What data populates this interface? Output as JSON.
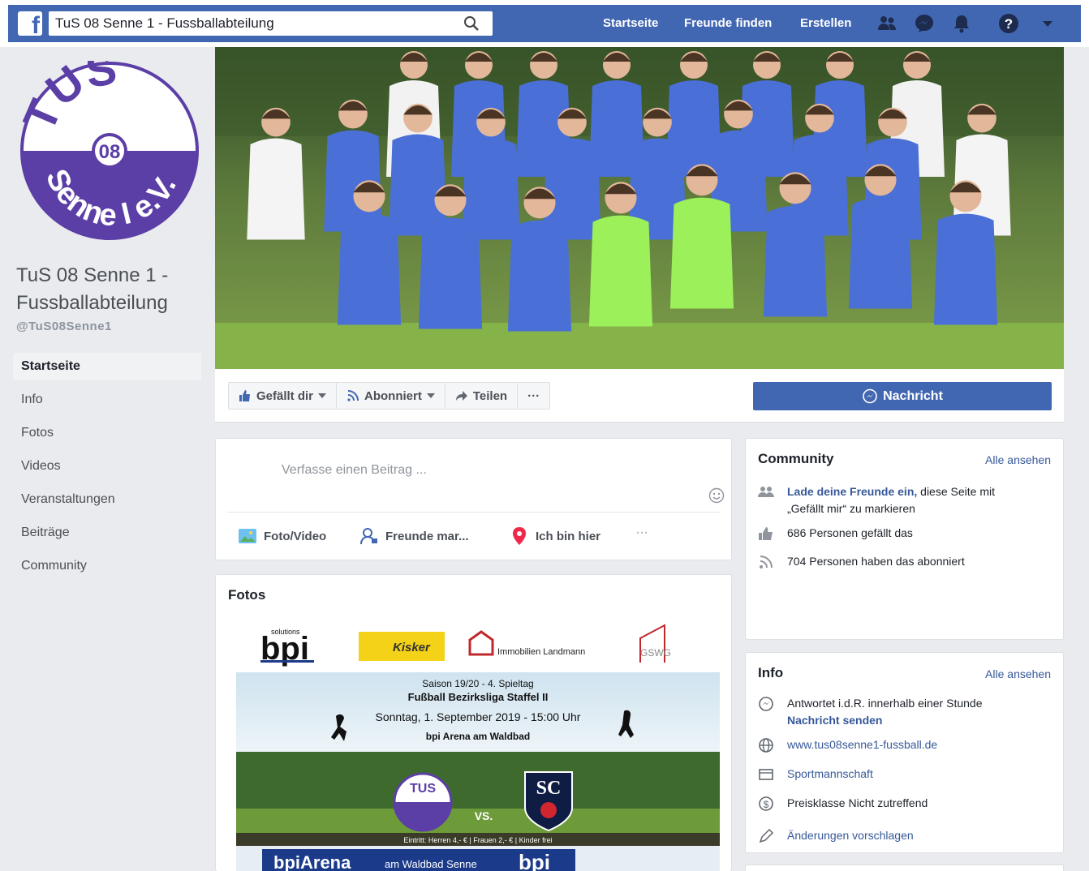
{
  "topbar": {
    "search_value": "TuS 08 Senne 1 - Fussballabteilung",
    "nav": [
      "Startseite",
      "Freunde finden",
      "Erstellen"
    ]
  },
  "page": {
    "name": "TuS 08 Senne 1 - Fussballabteilung",
    "handle": "@TuS08Senne1",
    "logo": {
      "top_text": "TUS",
      "middle_text": "08",
      "bottom_text": "Senne I e.V.",
      "color": "#5b3ea6"
    }
  },
  "sidebar": {
    "items": [
      "Startseite",
      "Info",
      "Fotos",
      "Videos",
      "Veranstaltungen",
      "Beiträge",
      "Community"
    ]
  },
  "actions": {
    "like": "Gefällt dir",
    "follow": "Abonniert",
    "share": "Teilen",
    "more": "···",
    "message": "Nachricht"
  },
  "composer": {
    "placeholder": "Verfasse einen Beitrag ...",
    "options": [
      "Foto/Video",
      "Freunde mar...",
      "Ich bin hier",
      "···"
    ]
  },
  "photos": {
    "title": "Fotos",
    "poster": {
      "season": "Saison 19/20 - 4. Spieltag",
      "league": "Fußball Bezirksliga Staffel II",
      "date": "Sonntag, 1. September 2019 - 15:00 Uhr",
      "venue": "bpi Arena am Waldbad",
      "vs": "VS.",
      "sponsor1": "bpi",
      "sponsor1_sub": "solutions",
      "sponsor2": "Kisker",
      "sponsor3": "Immobilien Landmann",
      "sponsor4": "GSWG",
      "opponent": "SC",
      "entry": "Eintritt: Herren 4,- € | Frauen 2,- € | Kinder frei",
      "arena": "bpiArena",
      "arena_sub": "am Waldbad Senne"
    }
  },
  "community": {
    "title": "Community",
    "see_all": "Alle ansehen",
    "invite_link": "Lade deine Freunde ein,",
    "invite_text": "diese Seite mit",
    "invite_text2": "„Gefällt mir“ zu markieren",
    "likes": "686 Personen gefällt das",
    "follows": "704 Personen haben das abonniert"
  },
  "info": {
    "title": "Info",
    "see_all": "Alle ansehen",
    "response": "Antwortet i.d.R. innerhalb einer Stunde",
    "send_message": "Nachricht senden",
    "website": "www.tus08senne1-fussball.de",
    "category": "Sportmannschaft",
    "price": "Preisklasse Nicht zutreffend",
    "suggest": "Änderungen vorschlagen"
  },
  "colors": {
    "brand": "#4267b2",
    "link": "#365899",
    "jersey": "#4a6fd6",
    "keeper": "#9cf05a",
    "club_purple": "#5b3ea6"
  }
}
